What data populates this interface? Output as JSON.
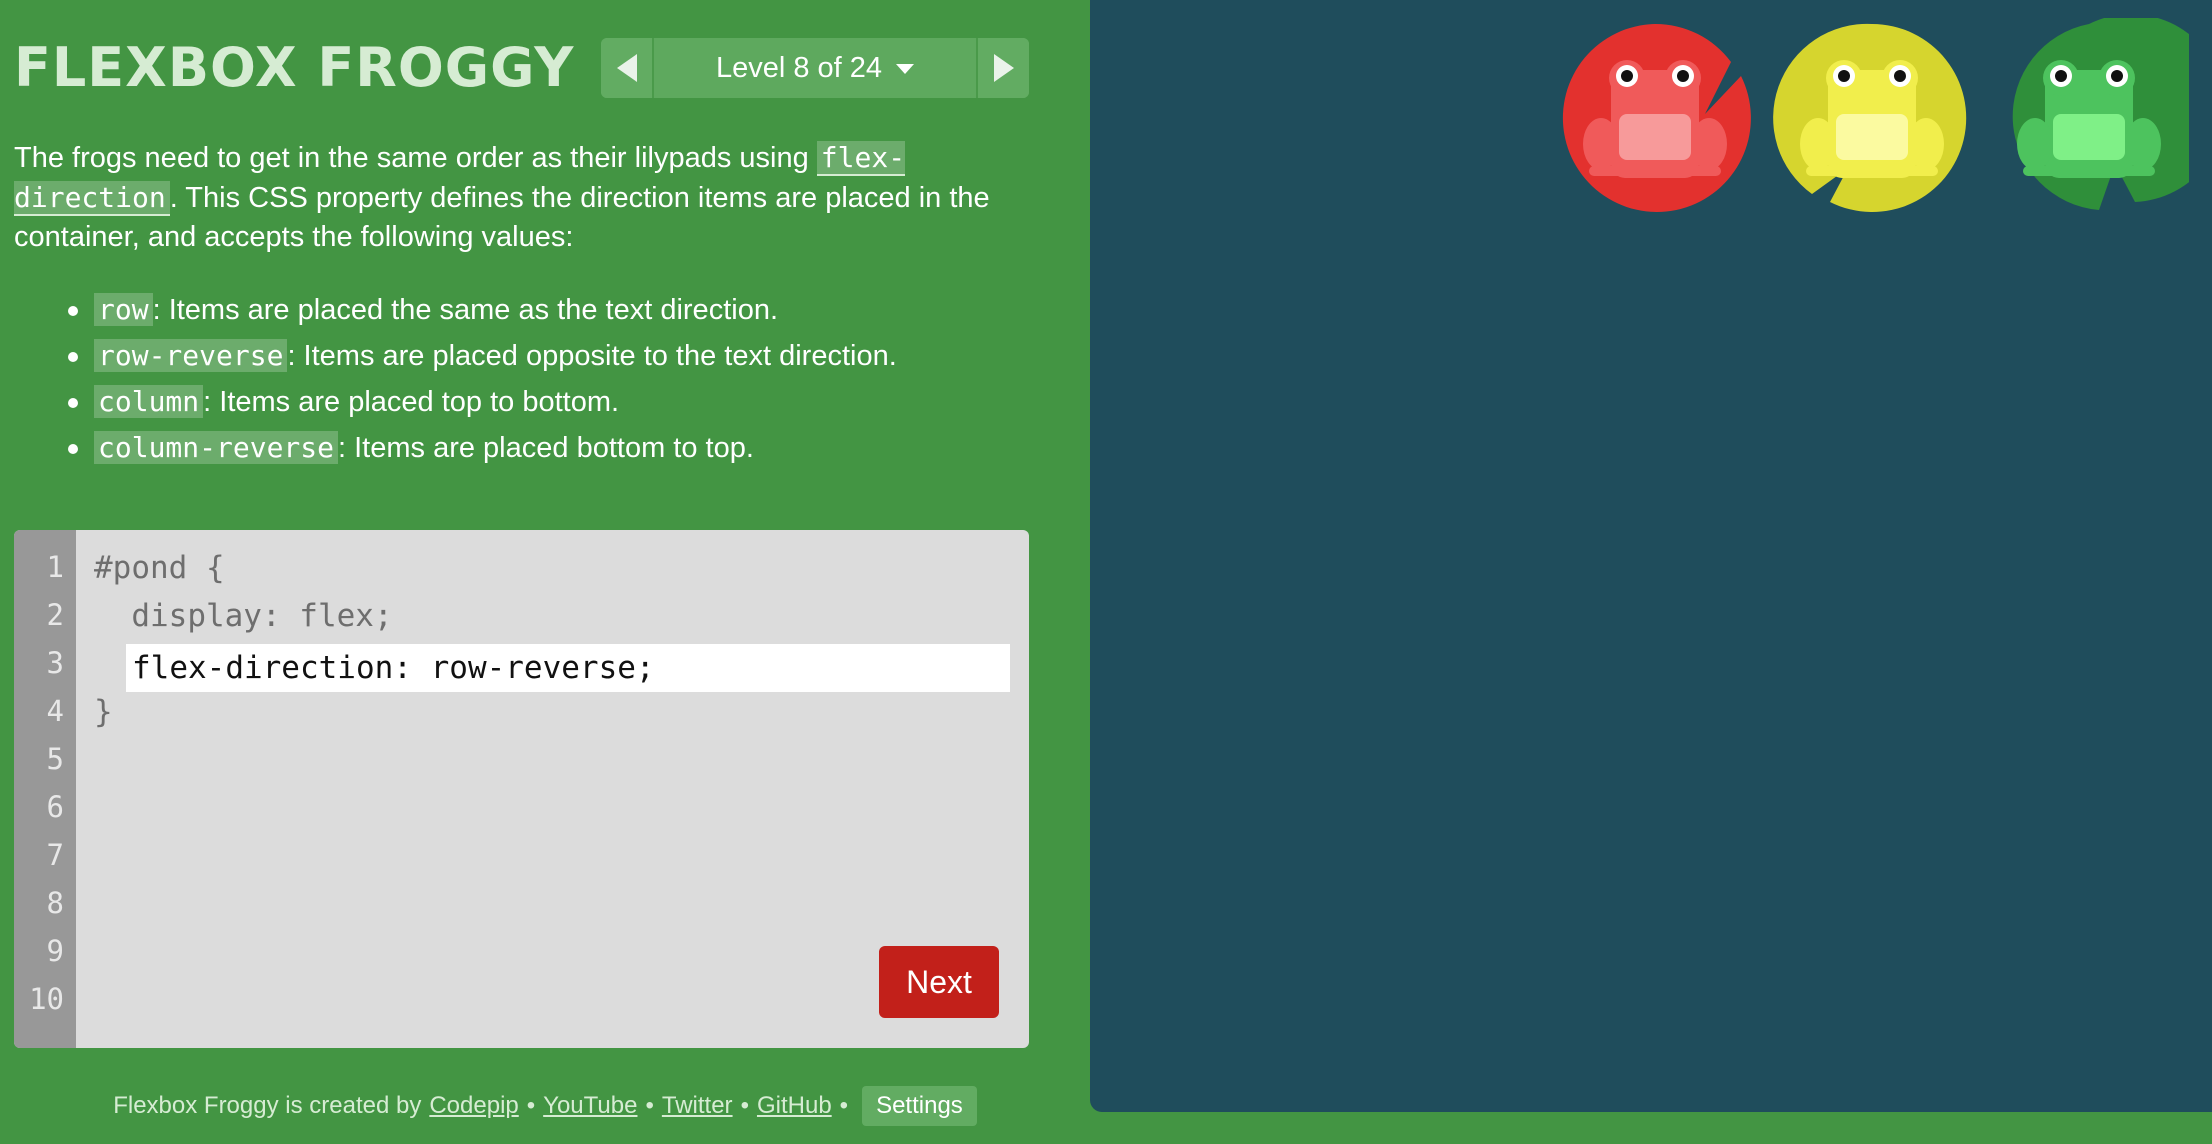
{
  "app": {
    "title": "FLEXBOX FROGGY"
  },
  "level_nav": {
    "label": "Level 8 of 24",
    "prev_icon": "triangle-left-icon",
    "next_icon": "triangle-right-icon",
    "dropdown_icon": "caret-down-icon"
  },
  "instructions": {
    "intro_before": "The frogs need to get in the same order as their lilypads using ",
    "property": "flex-direction",
    "intro_after": ". This CSS property defines the direction items are placed in the container, and accepts the following values:",
    "values": [
      {
        "code": "row",
        "desc": ": Items are placed the same as the text direction."
      },
      {
        "code": "row-reverse",
        "desc": ": Items are placed opposite to the text direction."
      },
      {
        "code": "column",
        "desc": ": Items are placed top to bottom."
      },
      {
        "code": "column-reverse",
        "desc": ": Items are placed bottom to top."
      }
    ]
  },
  "editor": {
    "line_numbers": [
      "1",
      "2",
      "3",
      "4",
      "5",
      "6",
      "7",
      "8",
      "9",
      "10"
    ],
    "line1": "#pond {",
    "line2": "  display: flex;",
    "input_value": "flex-direction: row-reverse;",
    "line4": "}",
    "next_label": "Next"
  },
  "footer": {
    "credit": "Flexbox Froggy is created by",
    "links": [
      "Codepip",
      "YouTube",
      "Twitter",
      "GitHub"
    ],
    "separator": "•",
    "settings_label": "Settings"
  },
  "pond": {
    "frogs": [
      {
        "color": "red",
        "pad_color": "#e3312e",
        "body_color": "#f05a5a",
        "belly_color": "#f79a9a"
      },
      {
        "color": "yellow",
        "pad_color": "#d6d52e",
        "body_color": "#f1ee4c",
        "belly_color": "#fbfaa0"
      },
      {
        "color": "green",
        "pad_color": "#2f8f3a",
        "body_color": "#4dc35e",
        "belly_color": "#7ff087"
      }
    ]
  },
  "colors": {
    "sidebar_bg": "#439543",
    "pond_bg": "#1f4d5c",
    "editor_bg": "#dcdcdc",
    "next_button": "#c2201a"
  }
}
